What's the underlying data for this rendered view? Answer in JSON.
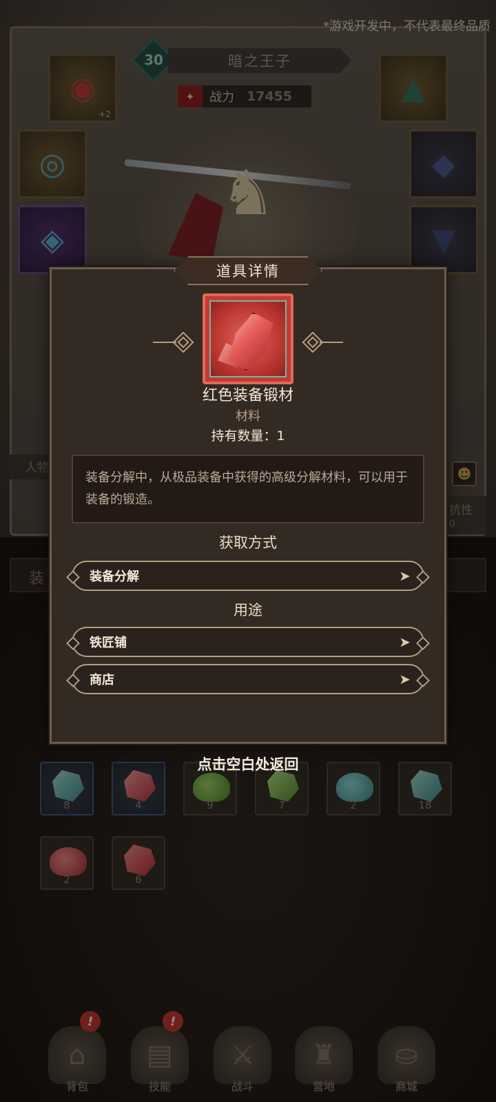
{
  "notice": "*游戏开发中，不代表最终品质",
  "character": {
    "level": "30",
    "name": "暗之王子",
    "power_label": "战力",
    "power_value": "17455"
  },
  "equipment_slots": [
    {
      "slot": "bracelet",
      "icon": "ruby-bracelet-icon",
      "extra": "+2"
    },
    {
      "slot": "ring",
      "icon": "sapphire-ring-icon"
    },
    {
      "slot": "amulet",
      "icon": "amulet-icon"
    },
    {
      "slot": "helmet",
      "icon": "feather-hat-icon"
    },
    {
      "slot": "armor",
      "icon": "chest-armor-icon"
    },
    {
      "slot": "pants",
      "icon": "leg-armor-icon"
    }
  ],
  "background": {
    "side_tab": "人物",
    "resist_label": "抗性",
    "resist_value": "0",
    "equip_tab": "装"
  },
  "dialog": {
    "title": "道具详情",
    "item": {
      "icon": "red-crystal-icon",
      "name": "红色装备锻材",
      "type": "材料",
      "owned": "持有数量：1",
      "description": "装备分解中，从极品装备中获得的高级分解材料，可以用于装备的锻造。"
    },
    "obtain_title": "获取方式",
    "obtain_items": [
      {
        "label": "装备分解",
        "icon": "arrow-right-icon"
      }
    ],
    "usage_title": "用途",
    "usage_items": [
      {
        "label": "铁匠铺",
        "icon": "arrow-right-icon"
      },
      {
        "label": "商店",
        "icon": "arrow-right-icon"
      }
    ]
  },
  "dismiss_hint": "点击空白处返回",
  "inventory": [
    {
      "color": "teal",
      "count": "8"
    },
    {
      "color": "red",
      "count": "4"
    },
    {
      "color": "green",
      "count": "9"
    },
    {
      "color": "green",
      "count": "7"
    },
    {
      "color": "teal",
      "count": "2"
    },
    {
      "color": "teal",
      "count": "18"
    },
    {
      "color": "red",
      "count": "2"
    },
    {
      "color": "red",
      "count": "6"
    }
  ],
  "colors": {
    "teal": "#5fb2b0",
    "red": "#d2454a",
    "green": "#6aa640",
    "accent_gold": "#b49f80",
    "dialog_bg": "#342a24"
  },
  "bottom_nav": [
    {
      "label": "背包",
      "icon": "backpack-icon",
      "badge": "!"
    },
    {
      "label": "技能",
      "icon": "skill-book-icon",
      "badge": "!"
    },
    {
      "label": "战斗",
      "icon": "battle-icon"
    },
    {
      "label": "营地",
      "icon": "castle-icon"
    },
    {
      "label": "商城",
      "icon": "shop-icon"
    }
  ]
}
